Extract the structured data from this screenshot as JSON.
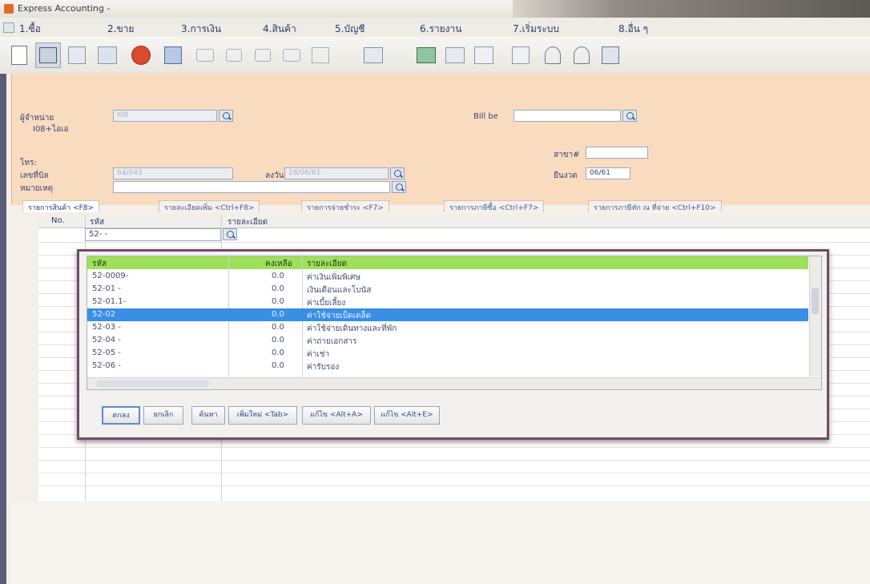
{
  "window": {
    "title": "Express Accounting -",
    "doc_title": "",
    "accent": "#3a8ee6"
  },
  "menu": [
    "1.ซื้อ",
    "2.ขาย",
    "3.การเงิน",
    "4.สินค้า",
    "5.บัญชี",
    "6.รายงาน",
    "7.เริ่มระบบ",
    "8.อื่น ๆ"
  ],
  "toolbar_icons": [
    "new-icon",
    "edit-icon",
    "copy-icon",
    "delete-icon",
    "cancel-icon",
    "save-icon",
    "first-icon",
    "prev-icon",
    "next-icon",
    "last-icon",
    "view-icon",
    "print-icon",
    "preview-icon",
    "calc-icon",
    "calendar-icon",
    "info-icon",
    "tools-icon",
    "print-form-icon",
    "report-icon"
  ],
  "form": {
    "supplier_label": "ผู้จำหน่าย",
    "supplier_code": "I08",
    "supplier_name": "I08+ไอเอ",
    "billbe_label": "Bill be",
    "phone_label": "โทร:",
    "branch_label": "สาขา#",
    "tax_id_label": "เลขที่บิล",
    "tax_id_value": "64/043",
    "date_label": "ลงวันที่",
    "date_value": "28/06/61",
    "period_label": "ยืนงวด",
    "period_value": "06/61",
    "note_label": "หมายเหตุ"
  },
  "tabs": [
    "รายการสินค้า <F8>",
    "รายละเอียดเพิ่ม <Ctrl+F8>",
    "รายการจ่ายชำระ <F7>",
    "รายการภาษีซื้อ <Ctrl+F7>",
    "รายการภาษีหัก ณ ที่จ่าย <Ctrl+F10>"
  ],
  "grid": {
    "col_no": "No.",
    "col_code": "รหัส",
    "col_desc": "รายละเอียด",
    "current_code": "52-  -"
  },
  "popup": {
    "headers": {
      "code": "รหัส",
      "balance": "คงเหลือ",
      "desc": "รายละเอียด"
    },
    "rows": [
      {
        "code": "52-0009-",
        "balance": "0.0",
        "desc": "ค่าเงินเพิ่มพิเศษ",
        "selected": false
      },
      {
        "code": "52-01  -",
        "balance": "0.0",
        "desc": "เงินเดือนและโบนัส",
        "selected": false
      },
      {
        "code": "52-01.1-",
        "balance": "0.0",
        "desc": "ค่าเบี้ยเลี้ยง",
        "selected": false
      },
      {
        "code": "52-02",
        "balance": "0.0",
        "desc": "ค่าใช้จ่ายเบ็ดเตล็ด",
        "selected": true
      },
      {
        "code": "52-03  -",
        "balance": "0.0",
        "desc": "ค่าใช้จ่ายเดินทางและที่พัก",
        "selected": false
      },
      {
        "code": "52-04  -",
        "balance": "0.0",
        "desc": "ค่าถ่ายเอกสาร",
        "selected": false
      },
      {
        "code": "52-05  -",
        "balance": "0.0",
        "desc": "ค่าเช่า",
        "selected": false
      },
      {
        "code": "52-06  -",
        "balance": "0.0",
        "desc": "ค่ารับรอง",
        "selected": false
      }
    ],
    "buttons": [
      "ตกลง",
      "ยกเลิก",
      "ค้นหา",
      "เพิ่มใหม่ <Tab>",
      "แก้ไข <Alt+A>",
      "แก้ไข <Alt+E>"
    ]
  }
}
